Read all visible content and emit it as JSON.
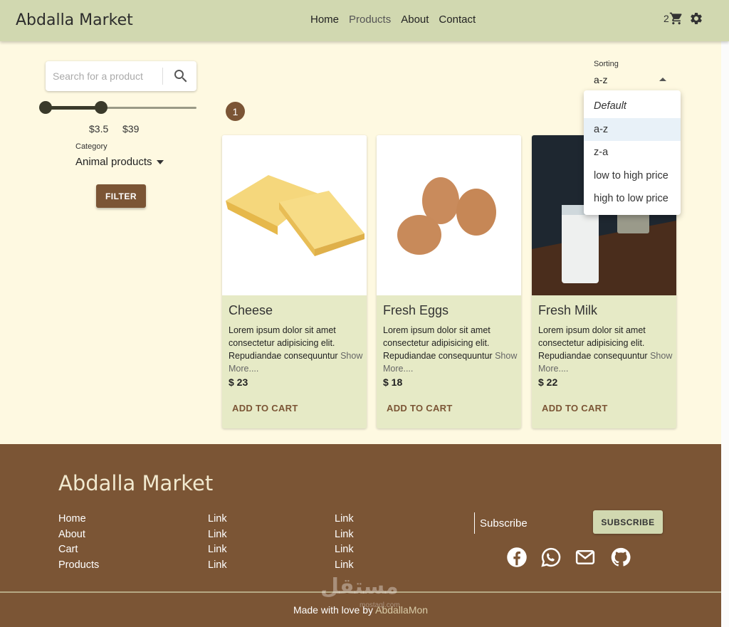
{
  "header": {
    "brand": "Abdalla Market",
    "nav": [
      "Home",
      "Products",
      "About",
      "Contact"
    ],
    "cart_count": "2"
  },
  "sidebar": {
    "search_placeholder": "Search for a product",
    "price_min": "$3.5",
    "price_max": "$39",
    "price_range_fraction": [
      0.0,
      0.37
    ],
    "category_label": "Category",
    "category_value": "Animal products",
    "filter_label": "FILTER"
  },
  "pagination": {
    "current_page": "1"
  },
  "sorting": {
    "label": "Sorting",
    "value": "a-z",
    "options": [
      "Default",
      "a-z",
      "z-a",
      "low to high price",
      "high to low price"
    ]
  },
  "products": [
    {
      "name": "Cheese",
      "description": "Lorem ipsum dolor sit amet consectetur adipisicing elit. Repudiandae consequuntur",
      "more": "Show More....",
      "price": "$ 23",
      "cta": "ADD TO CART"
    },
    {
      "name": "Fresh Eggs",
      "description": "Lorem ipsum dolor sit amet consectetur adipisicing elit. Repudiandae consequuntur",
      "more": "Show More....",
      "price": "$ 18",
      "cta": "ADD TO CART"
    },
    {
      "name": "Fresh Milk",
      "description": "Lorem ipsum dolor sit amet consectetur adipisicing elit. Repudiandae consequuntur",
      "more": "Show More....",
      "price": "$ 22",
      "cta": "ADD TO CART"
    }
  ],
  "footer": {
    "brand": "Abdalla Market",
    "col1": [
      "Home",
      "About",
      "Cart",
      "Products"
    ],
    "col2": [
      "Link",
      "Link",
      "Link",
      "Link"
    ],
    "col3": [
      "Link",
      "Link",
      "Link",
      "Link"
    ],
    "subscribe_placeholder": "Subscribe",
    "subscribe_button": "SUBSCRIBE",
    "social_icons": [
      "facebook-icon",
      "whatsapp-icon",
      "mail-icon",
      "github-icon"
    ],
    "made_with": "Made with love by",
    "author": "AbdallaMon",
    "watermark": "مستقل",
    "watermark_sub": "mostaql.com"
  },
  "colors": {
    "header_bg": "#d1d8b0",
    "page_bg": "#fef9e1",
    "accent_brown": "#7b5535",
    "card_bg": "#e6eac6"
  }
}
